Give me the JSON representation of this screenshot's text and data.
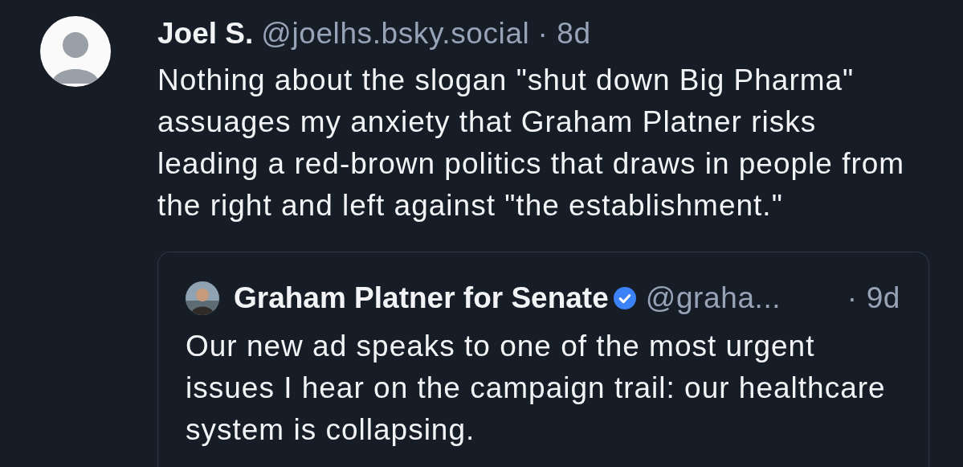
{
  "post": {
    "author": {
      "display_name": "Joel S.",
      "handle": "@joelhs.bsky.social",
      "time": "· 8d"
    },
    "text": "Nothing about the slogan \"shut down Big Pharma\" assuages my anxiety that Graham Platner risks leading a red-brown politics that draws in people from the right and left against \"the establishment.\"",
    "quote": {
      "author": {
        "display_name": "Graham Platner for Senate",
        "verified": true,
        "handle": "@graha...",
        "time": "· 9d"
      },
      "text": "Our new ad speaks to one of the most urgent issues I hear on the campaign trail: our healthcare system is collapsing."
    }
  }
}
